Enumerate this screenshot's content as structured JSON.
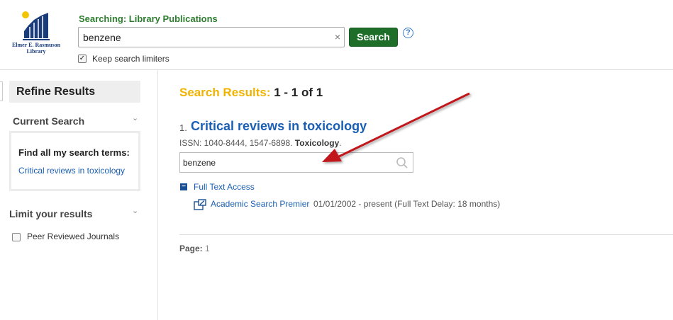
{
  "header": {
    "logo_text": "Elmer E. Rasmuson Library",
    "searching_label": "Searching: Library Publications",
    "search_value": "benzene",
    "clear_glyph": "×",
    "search_button": "Search",
    "help_glyph": "?",
    "keep_limiters_label": "Keep search limiters",
    "keep_limiters_checked": true
  },
  "sidebar": {
    "refine_title": "Refine Results",
    "current_search_title": "Current Search",
    "find_all_label": "Find all my search terms:",
    "find_all_term": "Critical reviews in toxicology",
    "limit_title": "Limit your results",
    "peer_reviewed_label": "Peer Reviewed Journals",
    "peer_reviewed_checked": false
  },
  "results": {
    "heading_label": "Search Results:",
    "heading_range": "1 - 1 of 1",
    "items": [
      {
        "number": "1.",
        "title": "Critical reviews in toxicology",
        "issn_text": "ISSN: 1040-8444, 1547-6898.",
        "subject": "Toxicology",
        "search_within_value": "benzene",
        "access_toggle": "−",
        "full_text_label": "Full Text Access",
        "source_name": "Academic Search Premier",
        "coverage": "01/01/2002 - present (Full Text Delay: 18 months)"
      }
    ],
    "page_label": "Page:",
    "page_number": "1"
  },
  "annotation": {
    "arrow_color": "#c0141a"
  },
  "colors": {
    "brand_green": "#1e6e2a",
    "results_yellow": "#f0b400",
    "link_blue": "#1a5fb4"
  },
  "icons": {
    "logo": "library-building-logo",
    "clear": "clear-icon",
    "help": "help-icon",
    "search_within": "magnifier-icon",
    "external": "external-link-icon",
    "collapse": "collapse-icon"
  }
}
